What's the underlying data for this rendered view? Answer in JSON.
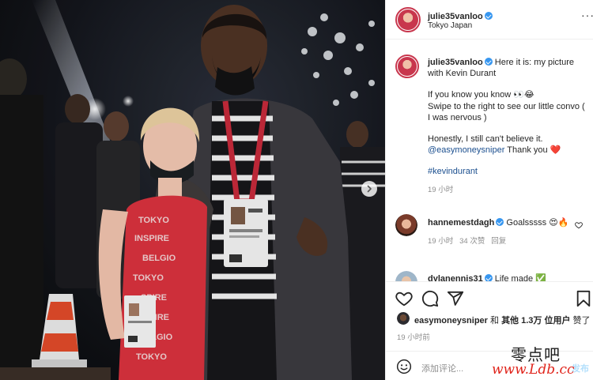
{
  "post": {
    "username": "julie35vanloo",
    "location": "Tokyo Japan",
    "more_glyph": "···"
  },
  "caption": {
    "username": "julie35vanloo",
    "line1": "Here it is: my picture with Kevin Durant",
    "line2": "If you know you know 👀😂",
    "line3": "Swipe to the right to see our little convo ( I was nervous )",
    "line4": "Honestly, I still can't believe it.",
    "mention": "@easymoneysniper",
    "line5_rest": " Thank you ❤️",
    "hashtag": "#kevindurant",
    "time": "19 小时"
  },
  "comments": [
    {
      "username": "hannemestdagh",
      "text": "Goalsssss 😍🔥",
      "time": "19 小时",
      "likes": "34 次赞",
      "reply": "回复"
    },
    {
      "username": "dylanennis31",
      "text": "Life made ✅"
    }
  ],
  "likes": {
    "liker": "easymoneysniper",
    "and": "和",
    "others": "其他 1.3万 位用户",
    "suffix": "赞了"
  },
  "time_ago": "19 小时前",
  "add_comment": {
    "placeholder": "添加评论...",
    "post_label": "发布"
  },
  "watermark": {
    "cn": "零点吧",
    "url": "www.Ldb.cc"
  },
  "colors": {
    "accent": "#3897f0",
    "link": "#1b4f8f",
    "heart": "#ed4956"
  },
  "icons": {
    "like": "heart-icon",
    "comment": "comment-icon",
    "share": "paper-plane-icon",
    "save": "bookmark-icon",
    "emoji": "smiley-icon",
    "next": "chevron-right-icon"
  }
}
